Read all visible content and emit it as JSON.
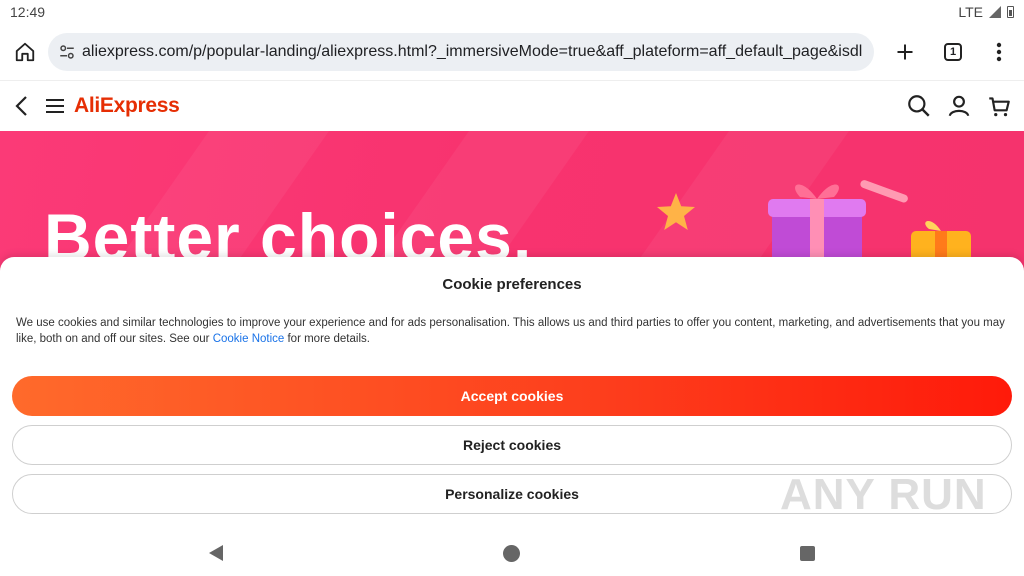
{
  "status_bar": {
    "time": "12:49",
    "network": "LTE"
  },
  "browser": {
    "url": "aliexpress.com/p/popular-landing/aliexpress.html?_immersiveMode=true&aff_plateform=aff_default_page&isdl",
    "tab_count": "1"
  },
  "site_header": {
    "logo": "AliExpress"
  },
  "banner": {
    "text": "Better choices,"
  },
  "cookie_sheet": {
    "title": "Cookie preferences",
    "body_text": "We use cookies and similar technologies to improve your experience and for ads personalisation. This allows us and third parties to offer you content, marketing, and advertisements that you may like, both on and off our sites. See our ",
    "link_text": "Cookie Notice",
    "body_suffix": " for more details.",
    "accept_label": "Accept cookies",
    "reject_label": "Reject cookies",
    "personalize_label": "Personalize cookies"
  },
  "watermark": "ANY RUN",
  "colors": {
    "brand": "#e62e04",
    "banner": "#f8336f",
    "accept_start": "#ff6a2b",
    "accept_end": "#ff1a0a",
    "link": "#1a73e8"
  }
}
